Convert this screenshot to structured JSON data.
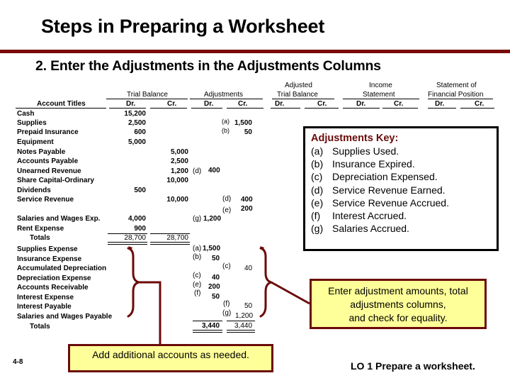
{
  "slide": {
    "title": "Steps in Preparing a Worksheet",
    "subtitle": "2. Enter the Adjustments in the Adjustments Columns",
    "slide_number": "4-8",
    "learning_objective": "LO 1  Prepare a worksheet."
  },
  "worksheet": {
    "column_groups": {
      "account_titles": "Account Titles",
      "trial_balance": "Trial Balance",
      "adjustments": "Adjustments",
      "adjusted_tb_line1": "Adjusted",
      "adjusted_tb_line2": "Trial Balance",
      "income_line1": "Income",
      "income_line2": "Statement",
      "sfp_line1": "Statement of",
      "sfp_line2": "Financial Position"
    },
    "dr": "Dr.",
    "cr": "Cr.",
    "accounts": [
      {
        "name": "Cash",
        "tb_dr": "15,200",
        "tb_cr": "",
        "adj_dr": "",
        "adj_dr_ref": "",
        "adj_cr": "",
        "adj_cr_ref": ""
      },
      {
        "name": "Supplies",
        "tb_dr": "2,500",
        "tb_cr": "",
        "adj_dr": "",
        "adj_dr_ref": "",
        "adj_cr": "1,500",
        "adj_cr_ref": "(a)"
      },
      {
        "name": "Prepaid Insurance",
        "tb_dr": "600",
        "tb_cr": "",
        "adj_dr": "",
        "adj_dr_ref": "",
        "adj_cr": "50",
        "adj_cr_ref": "(b)"
      },
      {
        "name": "Equipment",
        "tb_dr": "5,000",
        "tb_cr": "",
        "adj_dr": "",
        "adj_dr_ref": "",
        "adj_cr": "",
        "adj_cr_ref": ""
      },
      {
        "name": "Notes Payable",
        "tb_dr": "",
        "tb_cr": "5,000",
        "adj_dr": "",
        "adj_dr_ref": "",
        "adj_cr": "",
        "adj_cr_ref": ""
      },
      {
        "name": "Accounts Payable",
        "tb_dr": "",
        "tb_cr": "2,500",
        "adj_dr": "",
        "adj_dr_ref": "",
        "adj_cr": "",
        "adj_cr_ref": ""
      },
      {
        "name": "Unearned Revenue",
        "tb_dr": "",
        "tb_cr": "1,200",
        "adj_dr": "400",
        "adj_dr_ref": "(d)",
        "adj_cr": "",
        "adj_cr_ref": ""
      },
      {
        "name": "Share Capital-Ordinary",
        "tb_dr": "",
        "tb_cr": "10,000",
        "adj_dr": "",
        "adj_dr_ref": "",
        "adj_cr": "",
        "adj_cr_ref": ""
      },
      {
        "name": "Dividends",
        "tb_dr": "500",
        "tb_cr": "",
        "adj_dr": "",
        "adj_dr_ref": "",
        "adj_cr": "",
        "adj_cr_ref": ""
      },
      {
        "name": "Service Revenue",
        "tb_dr": "",
        "tb_cr": "10,000",
        "adj_dr": "",
        "adj_dr_ref": "",
        "adj_cr": "400",
        "adj_cr_ref": "(d)"
      },
      {
        "name": "",
        "tb_dr": "",
        "tb_cr": "",
        "adj_dr": "",
        "adj_dr_ref": "",
        "adj_cr": "200",
        "adj_cr_ref": "(e)"
      },
      {
        "name": "Salaries and Wages Exp.",
        "tb_dr": "4,000",
        "tb_cr": "",
        "adj_dr": "1,200",
        "adj_dr_ref": "(g)",
        "adj_cr": "",
        "adj_cr_ref": ""
      },
      {
        "name": "Rent Expense",
        "tb_dr": "900",
        "tb_cr": "",
        "adj_dr": "",
        "adj_dr_ref": "",
        "adj_cr": "",
        "adj_cr_ref": ""
      }
    ],
    "tb_totals": {
      "label": "Totals",
      "dr": "28,700",
      "cr": "28,700"
    },
    "added_accounts": [
      {
        "name": "Supplies Expense",
        "adj_dr": "1,500",
        "adj_dr_ref": "(a)",
        "adj_cr": "",
        "adj_cr_ref": ""
      },
      {
        "name": "Insurance Expense",
        "adj_dr": "50",
        "adj_dr_ref": "(b)",
        "adj_cr": "",
        "adj_cr_ref": ""
      },
      {
        "name": "Accumulated Depreciation",
        "adj_dr": "",
        "adj_dr_ref": "",
        "adj_cr": "40",
        "adj_cr_ref": "(c)"
      },
      {
        "name": "Depreciation Expense",
        "adj_dr": "40",
        "adj_dr_ref": "(c)",
        "adj_cr": "",
        "adj_cr_ref": ""
      },
      {
        "name": "Accounts Receivable",
        "adj_dr": "200",
        "adj_dr_ref": "(e)",
        "adj_cr": "",
        "adj_cr_ref": ""
      },
      {
        "name": "Interest Expense",
        "adj_dr": "50",
        "adj_dr_ref": "(f)",
        "adj_cr": "",
        "adj_cr_ref": ""
      },
      {
        "name": "Interest Payable",
        "adj_dr": "",
        "adj_dr_ref": "",
        "adj_cr": "50",
        "adj_cr_ref": "(f)"
      },
      {
        "name": "Salaries and Wages Payable",
        "adj_dr": "",
        "adj_dr_ref": "",
        "adj_cr": "1,200",
        "adj_cr_ref": "(g)"
      }
    ],
    "adj_totals": {
      "label": "Totals",
      "dr": "3,440",
      "cr": "3,440"
    }
  },
  "adjustments_key": {
    "title": "Adjustments Key:",
    "items": [
      {
        "key": "(a)",
        "text": "Supplies Used."
      },
      {
        "key": "(b)",
        "text": "Insurance Expired."
      },
      {
        "key": "(c)",
        "text": "Depreciation Expensed."
      },
      {
        "key": "(d)",
        "text": "Service Revenue Earned."
      },
      {
        "key": "(e)",
        "text": "Service Revenue Accrued."
      },
      {
        "key": "(f)",
        "text": "Interest Accrued."
      },
      {
        "key": "(g)",
        "text": "Salaries Accrued."
      }
    ]
  },
  "callouts": {
    "enter_amounts_line1": "Enter adjustment amounts, total",
    "enter_amounts_line2": "adjustments columns,",
    "enter_amounts_line3": "and check for equality.",
    "add_accounts": "Add additional accounts as needed."
  },
  "colors": {
    "accent": "#7a0a0a",
    "callout_fill": "#ffff99"
  }
}
